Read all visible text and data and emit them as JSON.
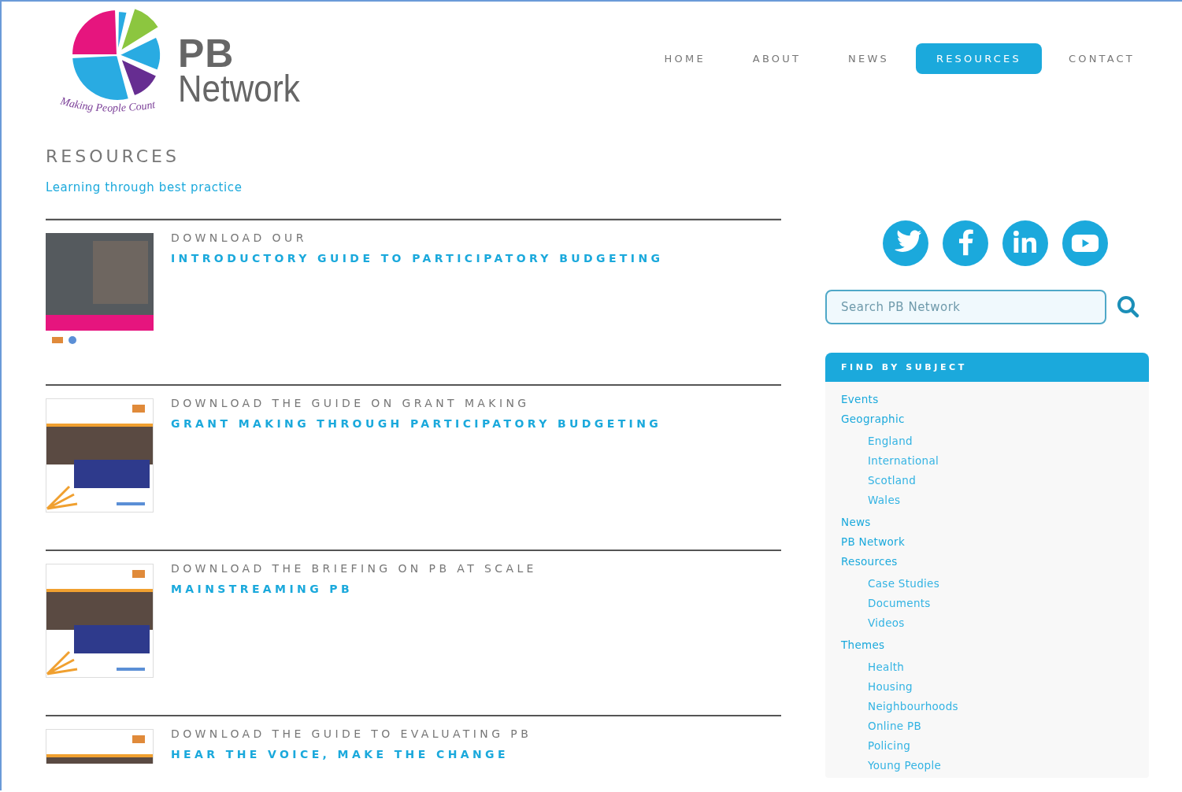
{
  "logo": {
    "initials": "PB",
    "name": "Network",
    "tagline": "Making People Count"
  },
  "nav": [
    {
      "label": "HOME",
      "selected": false
    },
    {
      "label": "ABOUT",
      "selected": false
    },
    {
      "label": "NEWS",
      "selected": false
    },
    {
      "label": "RESOURCES",
      "selected": true
    },
    {
      "label": "CONTACT",
      "selected": false
    }
  ],
  "page": {
    "title": "RESOURCES",
    "subtitle": "Learning through best practice"
  },
  "resources": [
    {
      "kind": "photo",
      "heading": "DOWNLOAD OUR",
      "link": "INTRODUCTORY GUIDE TO PARTICIPATORY BUDGETING"
    },
    {
      "kind": "report",
      "heading": "DOWNLOAD THE GUIDE ON GRANT MAKING",
      "link": "GRANT MAKING THROUGH PARTICIPATORY BUDGETING"
    },
    {
      "kind": "report",
      "heading": "DOWNLOAD THE BRIEFING ON PB AT SCALE",
      "link": "MAINSTREAMING PB"
    },
    {
      "kind": "report",
      "heading": "DOWNLOAD THE GUIDE TO EVALUATING PB",
      "link": "HEAR THE VOICE, MAKE THE CHANGE"
    }
  ],
  "search": {
    "placeholder": "Search PB Network"
  },
  "subjects": {
    "title": "FIND BY SUBJECT",
    "items": [
      {
        "label": "Events"
      },
      {
        "label": "Geographic",
        "children": [
          {
            "label": "England"
          },
          {
            "label": "International"
          },
          {
            "label": "Scotland"
          },
          {
            "label": "Wales"
          }
        ]
      },
      {
        "label": "News"
      },
      {
        "label": "PB Network"
      },
      {
        "label": "Resources",
        "children": [
          {
            "label": "Case Studies"
          },
          {
            "label": "Documents"
          },
          {
            "label": "Videos"
          }
        ]
      },
      {
        "label": "Themes",
        "children": [
          {
            "label": "Health"
          },
          {
            "label": "Housing"
          },
          {
            "label": "Neighbourhoods"
          },
          {
            "label": "Online PB"
          },
          {
            "label": "Policing"
          },
          {
            "label": "Young People"
          }
        ]
      }
    ]
  }
}
